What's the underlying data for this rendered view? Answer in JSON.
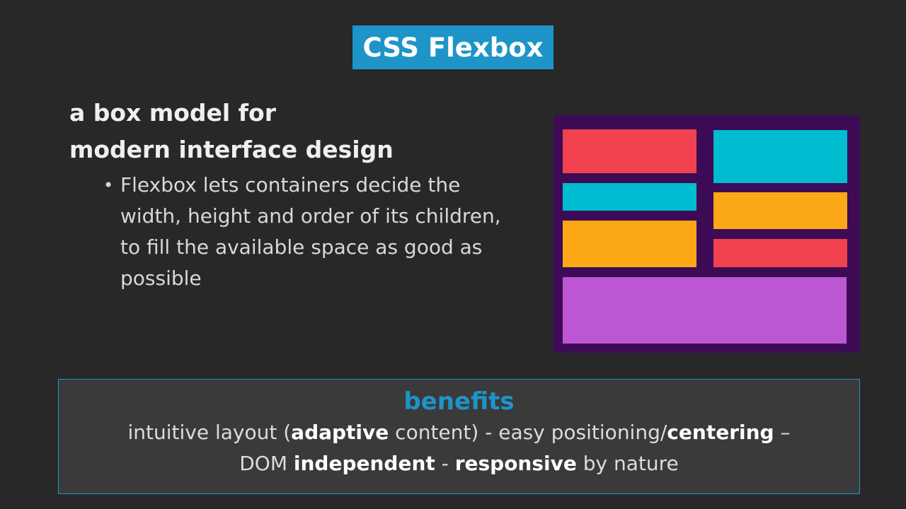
{
  "title": "CSS Flexbox",
  "heading": {
    "line1": "a box model for",
    "line2": "modern interface design"
  },
  "bullet": {
    "marker": "•",
    "text": "Flexbox lets containers decide the width, height and order of its children, to fill the available space as good as possible"
  },
  "benefits": {
    "title": "benefits",
    "line1": [
      {
        "text": "intuitive layout (",
        "bold": false
      },
      {
        "text": "adaptive",
        "bold": true
      },
      {
        "text": " content) - easy positioning/",
        "bold": false
      },
      {
        "text": "centering",
        "bold": true
      },
      {
        "text": " –",
        "bold": false
      }
    ],
    "line2": [
      {
        "text": "DOM ",
        "bold": false
      },
      {
        "text": "independent",
        "bold": true
      },
      {
        "text": " - ",
        "bold": false
      },
      {
        "text": "responsive",
        "bold": true
      },
      {
        "text": " by nature",
        "bold": false
      }
    ]
  },
  "colors": {
    "accent": "#1e94c8",
    "background": "#282828",
    "illustration_bg": "#3d0b56",
    "red": "#f2414f",
    "cyan": "#00bcd0",
    "orange": "#fca716",
    "purple": "#bc56d3"
  }
}
